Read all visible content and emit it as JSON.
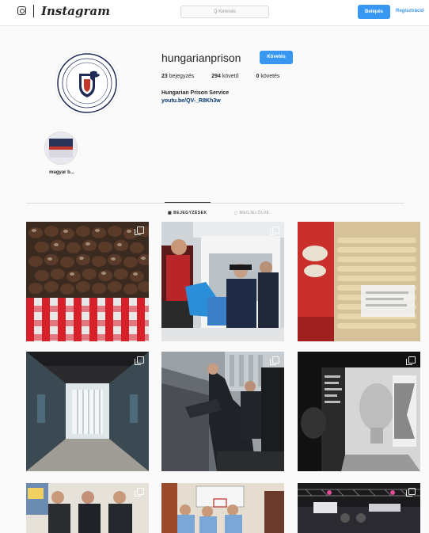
{
  "topbar": {
    "wordmark": "Instagram",
    "search_placeholder": "Q Keresés",
    "login_label": "Belépés",
    "register_label": "Regisztráció"
  },
  "profile": {
    "username": "hungarianprison",
    "follow_label": "Követés",
    "posts_count": "23",
    "posts_label": "bejegyzés",
    "followers_count": "294",
    "followers_label": "követő",
    "following_count": "0",
    "following_label": "követés",
    "full_name": "Hungarian Prison Service",
    "bio_link": "youtu.be/QV-_R8Kh3w"
  },
  "highlights": [
    {
      "label": "magyar b..."
    }
  ],
  "tabs": [
    {
      "label": "BEJEGYZÉSEK"
    },
    {
      "label": "MEGJELÖLVE"
    }
  ],
  "colors": {
    "accent": "#3897f0",
    "text": "#262626"
  }
}
